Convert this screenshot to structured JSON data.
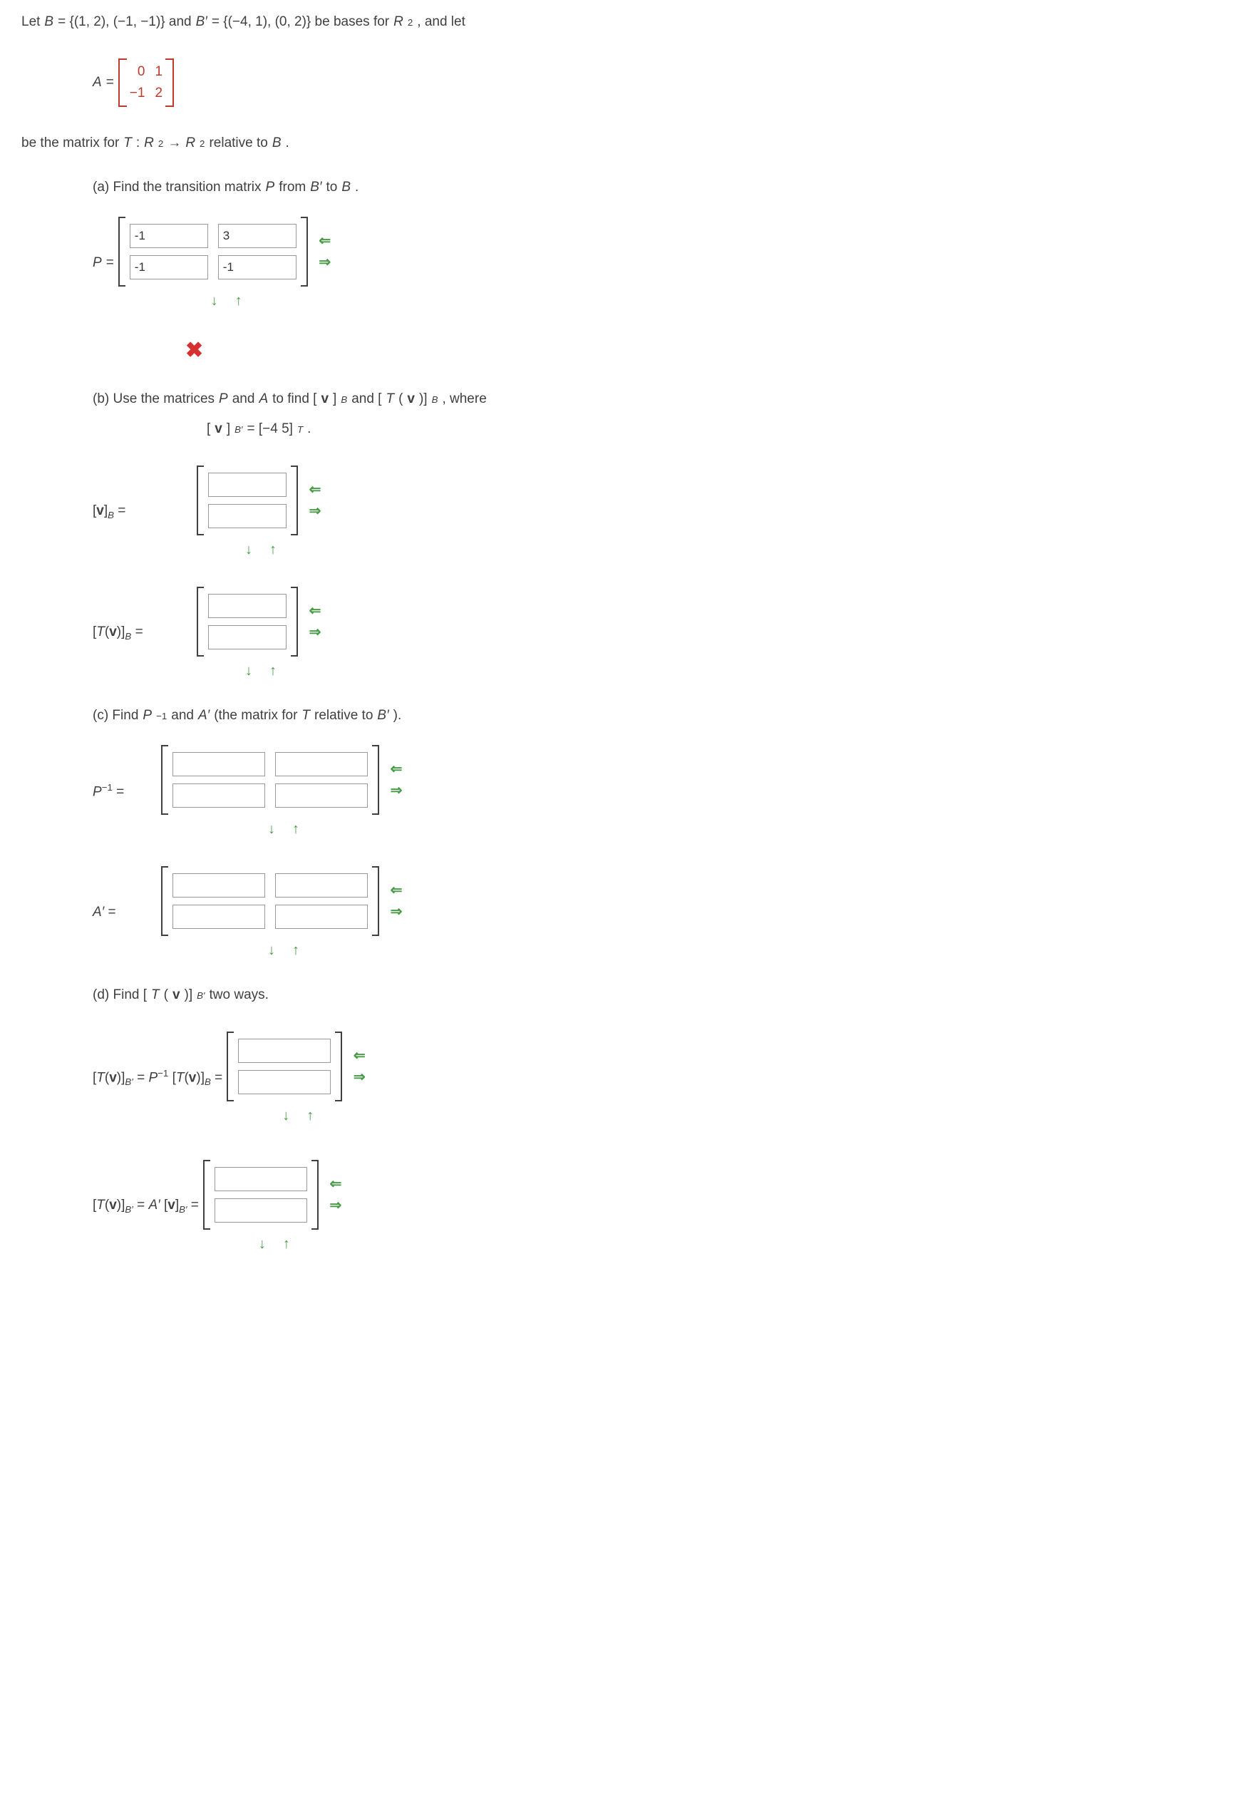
{
  "intro": {
    "let": "Let ",
    "B": "B",
    "eq1": " = {(1, 2), (−1, −1)} and ",
    "Bp": "B′",
    "eq2": " = {(−4, 1), (0, 2)} be bases for ",
    "R2": "R",
    "sup2": "2",
    "andlet": ", and let"
  },
  "matrixA": {
    "label": "A",
    "eq": " = ",
    "cells": [
      "0",
      "1",
      "−1",
      "2"
    ]
  },
  "line2": {
    "pre": "be the matrix for  ",
    "T": "T",
    "colon": ": ",
    "R": "R",
    "two": "2",
    "arrow": " → ",
    "rel": " relative to ",
    "B": "B",
    "dot": "."
  },
  "partA": {
    "text1": "(a) Find the transition matrix ",
    "P": "P",
    "text2": " from ",
    "Bp": "B′",
    "text3": " to ",
    "B": "B",
    "dot": ".",
    "Plabel": "P",
    "eq": " = ",
    "values": [
      "-1",
      "3",
      "-1",
      "-1"
    ]
  },
  "partB": {
    "text1": "(b) Use the matrices ",
    "P": "P",
    "and": " and ",
    "A": "A",
    "text2": " to find [",
    "v": "v",
    "rbB": "]",
    "Bsub": "B",
    "text3": " and [",
    "T": "T",
    "paren": "(",
    "v2": "v",
    "cparen": ")]",
    "Bsub2": "B",
    "where": " , where",
    "eq_line_lhs_open": "[",
    "eq_line_v": "v",
    "eq_line_close": "]",
    "eq_line_sub": "B′",
    "eq_line_eq": " = [−4  5]",
    "eq_line_T": "T",
    "eq_line_dot": ".",
    "vB_label_open": "[",
    "vB_label_v": "v",
    "vB_label_close": "]",
    "vB_label_sub": "B",
    "vB_label_eq": "  =  ",
    "TvB_label_open": "[",
    "TvB_label_T": "T",
    "TvB_label_p": "(",
    "TvB_label_v": "v",
    "TvB_label_cp": ")]",
    "TvB_label_sub": "B",
    "TvB_label_eq": "  =  "
  },
  "partC": {
    "text1": "(c) Find ",
    "P": "P",
    "neg1": "−1",
    "and": " and ",
    "Ap": "A′",
    "text2": " (the matrix for ",
    "T": "T",
    "rel": " relative to ",
    "Bp": "B′",
    "cparen": ").",
    "Pinv_label": "P",
    "Pinv_sup": "−1",
    "Pinv_eq": " = ",
    "Ap_label": "A′",
    "Ap_eq": " = "
  },
  "partD": {
    "text1": "(d) Find  [",
    "T": "T",
    "p": "(",
    "v": "v",
    "cp": ")]",
    "sub": "B′",
    "two": "  two ways.",
    "eq1_lhs_open": "[",
    "eq1_lhs_T": "T",
    "eq1_lhs_p": "(",
    "eq1_lhs_v": "v",
    "eq1_lhs_cp": ")]",
    "eq1_lhs_sub": "B′",
    "eq1_mid": " = ",
    "eq1_P": "P",
    "eq1_Psup": "−1",
    "eq1_open2": "[",
    "eq1_T2": "T",
    "eq1_p2": "(",
    "eq1_v2": "v",
    "eq1_cp2": ")]",
    "eq1_sub2": "B",
    "eq1_eq2": "  =  ",
    "eq2_lhs_open": "[",
    "eq2_lhs_T": "T",
    "eq2_lhs_p": "(",
    "eq2_lhs_v": "v",
    "eq2_lhs_cp": ")]",
    "eq2_lhs_sub": "B′",
    "eq2_mid": " = ",
    "eq2_Ap": "A′",
    "eq2_open2": "[",
    "eq2_v2": "v",
    "eq2_cp2": "]",
    "eq2_sub2": "B′",
    "eq2_eq2": "  =  "
  },
  "icons": {
    "remove_col": "⇐",
    "add_col": "⇒",
    "remove_row": "↓",
    "add_row": "↑",
    "wrong": "✖"
  }
}
